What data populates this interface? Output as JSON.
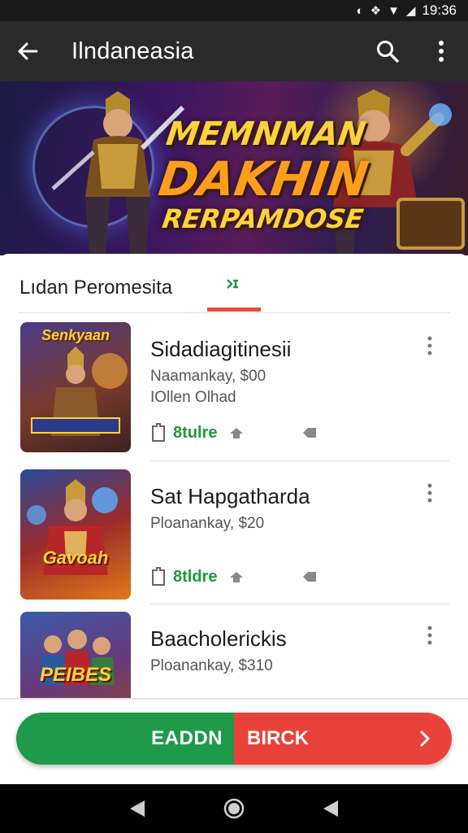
{
  "status_bar": {
    "time": "19:36",
    "signal_text": "⁴ᴵ"
  },
  "app_bar": {
    "title": "Ilndaneasia"
  },
  "banner": {
    "line1": "MEMNMAN",
    "line2": "DAKHIN",
    "line3": "RERPAMDOSE"
  },
  "tabs": {
    "active_label": "Lıdan Peromesita"
  },
  "apps": [
    {
      "title": "Sidadiagitinesii",
      "subtitle": "Naamankay, $00",
      "detail": "IOllen Olhad",
      "store_label": "8tulre",
      "thumb_text": "Senkyaan"
    },
    {
      "title": "Sat Hapgatharda",
      "subtitle": "Ploanankay, $20",
      "detail": "",
      "store_label": "8tldre",
      "thumb_text": "Gavoah"
    },
    {
      "title": "Baacholerickis",
      "subtitle": "Ploanankay, $310",
      "detail": "",
      "store_label": "",
      "thumb_text": "PEIBES"
    }
  ],
  "cta": {
    "left_label": "EADDN",
    "right_label": "BIRCK"
  },
  "colors": {
    "accent_red": "#e34e3b",
    "store_green": "#1b9a3a",
    "cta_green": "#1f9a4b",
    "cta_red": "#e8423a"
  }
}
